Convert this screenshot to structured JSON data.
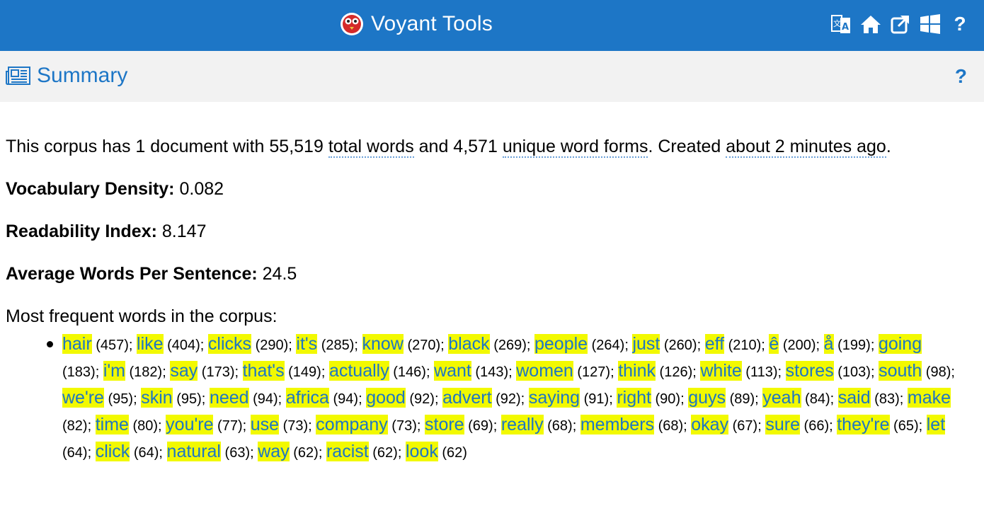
{
  "app": {
    "title": "Voyant Tools",
    "logo_icon": "voyant-owl-icon"
  },
  "toolbar": {
    "icons": [
      "translate-icon",
      "home-icon",
      "external-link-icon",
      "windows-icon",
      "help-icon"
    ],
    "help_label": "?"
  },
  "panel": {
    "title": "Summary",
    "help_label": "?"
  },
  "summary": {
    "s1": "This corpus has 1 document with 55,519 ",
    "total_words": "total words",
    "s2": " and 4,571 ",
    "unique_forms": "unique word forms",
    "s3": ". Created ",
    "created": "about 2 minutes ago",
    "s4": ".",
    "density_label": "Vocabulary Density:",
    "density_value": "0.082",
    "readability_label": "Readability Index:",
    "readability_value": "8.147",
    "avg_label": "Average Words Per Sentence:",
    "avg_value": "24.5",
    "frequent_title": "Most frequent words in the corpus:"
  },
  "frequent_words": [
    {
      "w": "hair",
      "c": "(457)"
    },
    {
      "w": "like",
      "c": "(404)"
    },
    {
      "w": "clicks",
      "c": "(290)"
    },
    {
      "w": "it's",
      "c": "(285)"
    },
    {
      "w": "know",
      "c": "(270)"
    },
    {
      "w": "black",
      "c": "(269)"
    },
    {
      "w": "people",
      "c": "(264)"
    },
    {
      "w": "just",
      "c": "(260)"
    },
    {
      "w": "eff",
      "c": "(210)"
    },
    {
      "w": "ê",
      "c": "(200)"
    },
    {
      "w": "å",
      "c": "(199)"
    },
    {
      "w": "going",
      "c": "(183)"
    },
    {
      "w": "i'm",
      "c": "(182)"
    },
    {
      "w": "say",
      "c": "(173)"
    },
    {
      "w": "that's",
      "c": "(149)"
    },
    {
      "w": "actually",
      "c": "(146)"
    },
    {
      "w": "want",
      "c": "(143)"
    },
    {
      "w": "women",
      "c": "(127)"
    },
    {
      "w": "think",
      "c": "(126)"
    },
    {
      "w": "white",
      "c": "(113)"
    },
    {
      "w": "stores",
      "c": "(103)"
    },
    {
      "w": "south",
      "c": "(98)"
    },
    {
      "w": "we're",
      "c": "(95)"
    },
    {
      "w": "skin",
      "c": "(95)"
    },
    {
      "w": "need",
      "c": "(94)"
    },
    {
      "w": "africa",
      "c": "(94)"
    },
    {
      "w": "good",
      "c": "(92)"
    },
    {
      "w": "advert",
      "c": "(92)"
    },
    {
      "w": "saying",
      "c": "(91)"
    },
    {
      "w": "right",
      "c": "(90)"
    },
    {
      "w": "guys",
      "c": "(89)"
    },
    {
      "w": "yeah",
      "c": "(84)"
    },
    {
      "w": "said",
      "c": "(83)"
    },
    {
      "w": "make",
      "c": "(82)"
    },
    {
      "w": "time",
      "c": "(80)"
    },
    {
      "w": "you're",
      "c": "(77)"
    },
    {
      "w": "use",
      "c": "(73)"
    },
    {
      "w": "company",
      "c": "(73)"
    },
    {
      "w": "store",
      "c": "(69)"
    },
    {
      "w": "really",
      "c": "(68)"
    },
    {
      "w": "members",
      "c": "(68)"
    },
    {
      "w": "okay",
      "c": "(67)"
    },
    {
      "w": "sure",
      "c": "(66)"
    },
    {
      "w": "they're",
      "c": "(65)"
    },
    {
      "w": "let",
      "c": "(64)"
    },
    {
      "w": "click",
      "c": "(64)"
    },
    {
      "w": "natural",
      "c": "(63)"
    },
    {
      "w": "way",
      "c": "(62)"
    },
    {
      "w": "racist",
      "c": "(62)"
    },
    {
      "w": "look",
      "c": "(62)"
    }
  ],
  "colors": {
    "accent": "#1d76c6",
    "highlight": "#f2f900",
    "panel_bg": "#f2f2f2"
  }
}
